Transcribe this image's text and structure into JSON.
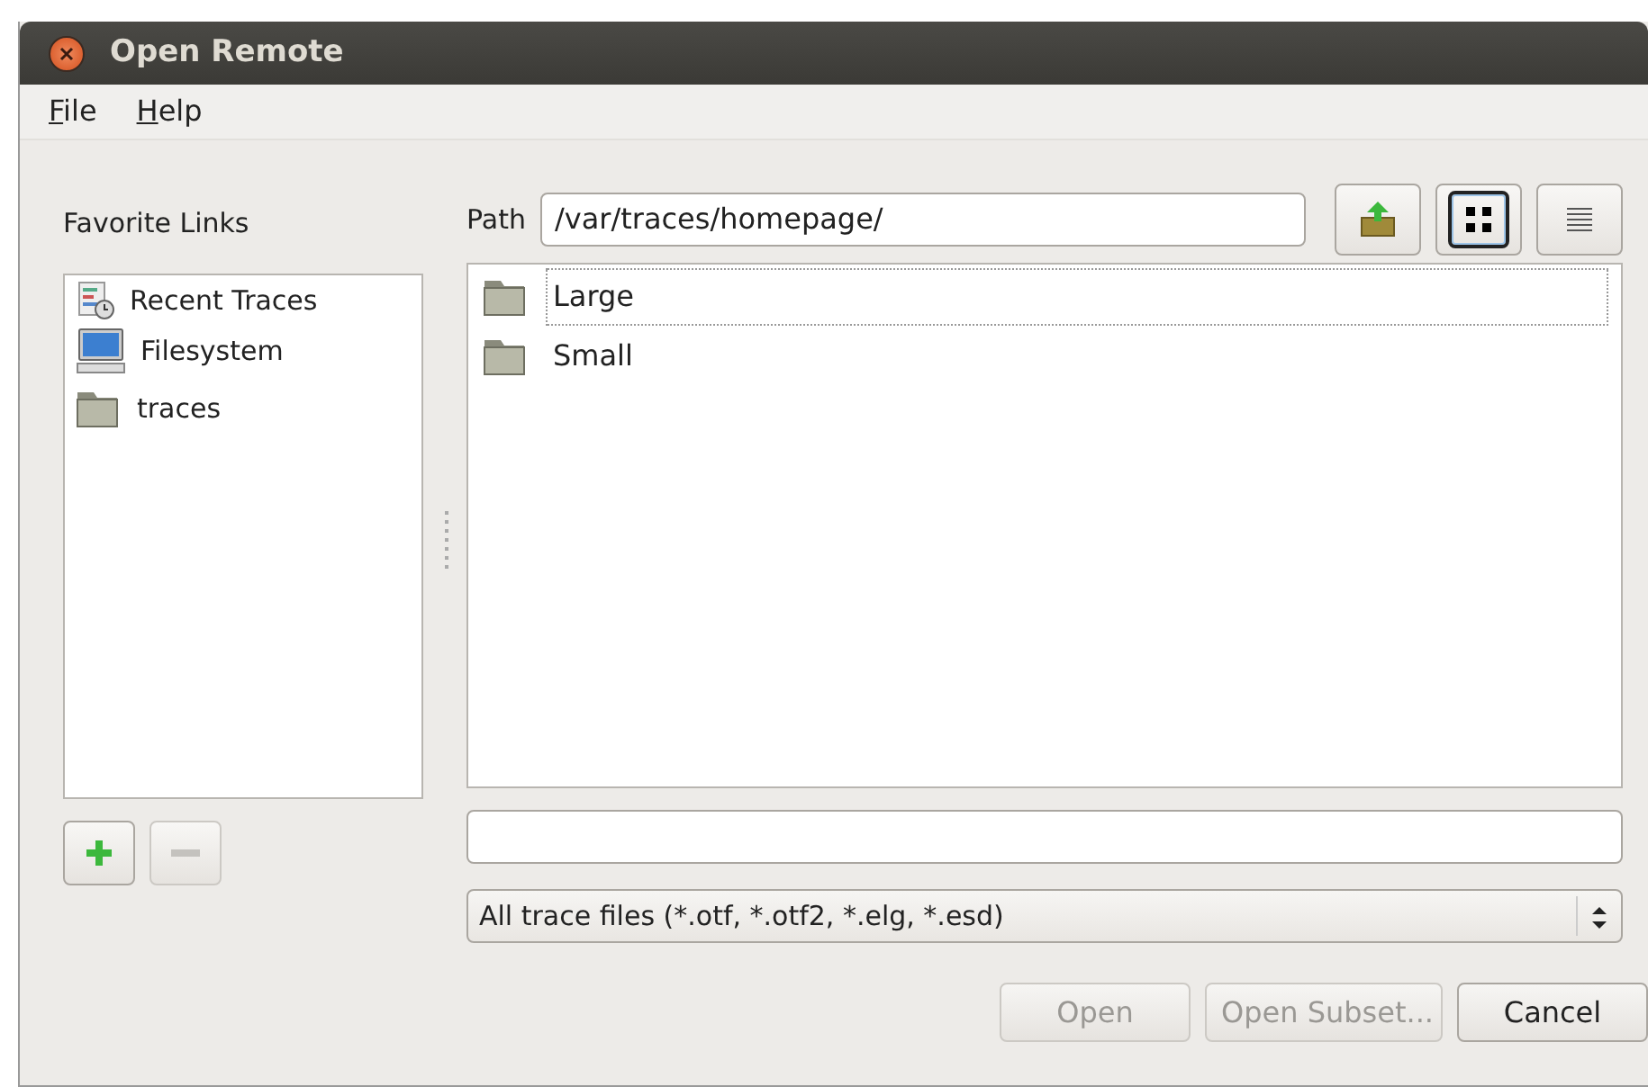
{
  "window": {
    "title": "Open Remote"
  },
  "menu": [
    "File",
    "Help"
  ],
  "favorites": {
    "label": "Favorite Links",
    "items": [
      {
        "label": "Recent Traces",
        "kind": "recent"
      },
      {
        "label": "Filesystem",
        "kind": "computer"
      },
      {
        "label": "traces",
        "kind": "folder"
      }
    ]
  },
  "path": {
    "label": "Path",
    "value": "/var/traces/homepage/"
  },
  "view_buttons": [
    {
      "kind": "up",
      "selected": false
    },
    {
      "kind": "icons",
      "selected": true
    },
    {
      "kind": "list",
      "selected": false
    }
  ],
  "files": [
    {
      "label": "Large",
      "selected": true
    },
    {
      "label": "Small",
      "selected": false
    }
  ],
  "favorite_buttons": [
    {
      "kind": "add",
      "disabled": false
    },
    {
      "kind": "remove",
      "disabled": true
    }
  ],
  "filter": "All trace files (*.otf, *.otf2, *.elg, *.esd)",
  "buttons": [
    {
      "label": "Open",
      "disabled": true
    },
    {
      "label": "Open Subset...",
      "disabled": true
    },
    {
      "label": "Cancel",
      "disabled": false
    }
  ]
}
